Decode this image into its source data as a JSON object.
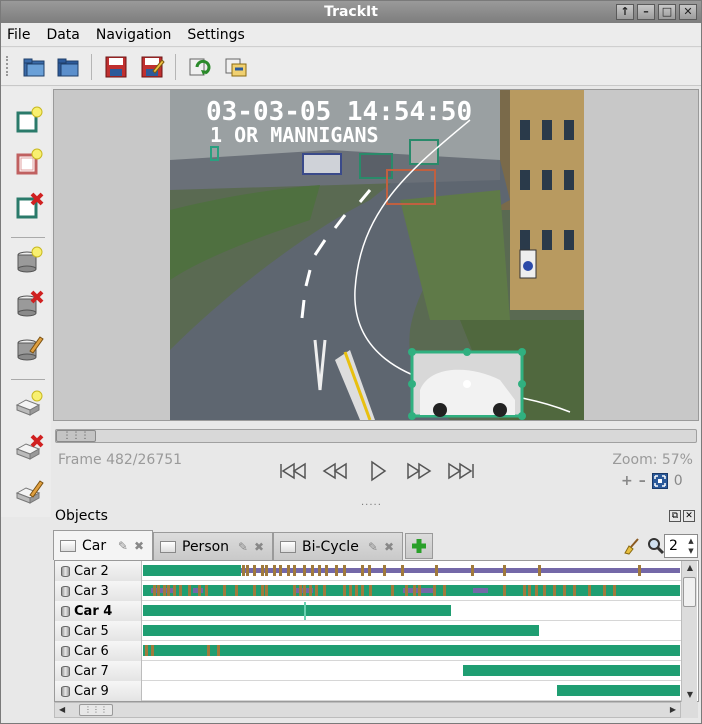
{
  "window": {
    "title": "TrackIt",
    "buttons": [
      "↑",
      "–",
      "□",
      "✕"
    ]
  },
  "menu": [
    "File",
    "Data",
    "Navigation",
    "Settings"
  ],
  "toolbar": {
    "icons": [
      "open-folder-icon",
      "open-folder-alt-icon",
      "save-icon",
      "save-as-icon",
      "export-icon",
      "import-icon"
    ]
  },
  "left_tools": {
    "icons": [
      "new-box-icon",
      "copy-box-icon",
      "delete-box-icon",
      "new-object-icon",
      "delete-object-icon",
      "edit-object-icon",
      "new-key-icon",
      "delete-key-icon",
      "edit-key-icon"
    ]
  },
  "video": {
    "overlay_line1": "03-03-05 14:54:50",
    "overlay_line2": "1 OR MANNIGANS"
  },
  "player": {
    "frame": "Frame 482/26751",
    "zoom": "Zoom: 57%",
    "zoom_value": "0",
    "splitter": "....."
  },
  "objects": {
    "title": "Objects",
    "tabs": [
      {
        "label": "Car",
        "active": true
      },
      {
        "label": "Person",
        "active": false
      },
      {
        "label": "Bi-Cycle",
        "active": false
      }
    ],
    "spin_value": "2",
    "rows": [
      {
        "label": "Car 2",
        "bold": false
      },
      {
        "label": "Car 3",
        "bold": false
      },
      {
        "label": "Car 4",
        "bold": true
      },
      {
        "label": "Car 5",
        "bold": false
      },
      {
        "label": "Car 6",
        "bold": false
      },
      {
        "label": "Car 7",
        "bold": false
      },
      {
        "label": "Car 9",
        "bold": false
      }
    ]
  },
  "colors": {
    "track_green": "#1f9e72",
    "track_purple": "#7468a8",
    "key_brown": "#a07a3c"
  }
}
